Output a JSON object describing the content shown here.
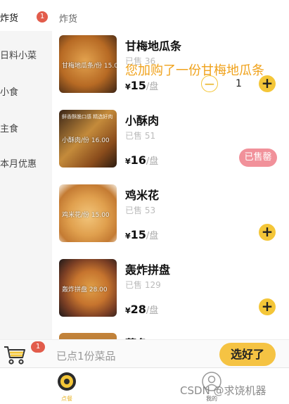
{
  "sidebar": {
    "active": "炸货",
    "items": [
      "日料小菜",
      "小食",
      "主食",
      "本月优惠"
    ],
    "badge": "1"
  },
  "top_tab": "炸货",
  "toast": "您加购了一份甘梅地瓜条",
  "dishes": [
    {
      "name": "甘梅地瓜条",
      "sold": "已售 36",
      "currency": "¥",
      "price": "15",
      "unit": "/盘",
      "overlay": "甘梅地瓜条/份 15.00",
      "quantity": "1"
    },
    {
      "name": "小酥肉",
      "sold": "已售 51",
      "currency": "¥",
      "price": "16",
      "unit": "/盘",
      "overlay": "小酥肉/份 16.00",
      "top_note": "鲜香酥脆口感 精选好肉",
      "status": "已售罄"
    },
    {
      "name": "鸡米花",
      "sold": "已售 53",
      "currency": "¥",
      "price": "15",
      "unit": "/盘",
      "overlay": "鸡米花/份 15.00"
    },
    {
      "name": "轰炸拼盘",
      "sold": "已售 129",
      "currency": "¥",
      "price": "28",
      "unit": "/盘",
      "overlay": "轰炸拼盘 28.00"
    },
    {
      "name": "薯条"
    }
  ],
  "cart": {
    "badge": "1",
    "text": "已点1份菜品",
    "button": "选好了"
  },
  "tabbar": {
    "home_label": "点餐",
    "me_label": "我的"
  },
  "watermark": "CSDN @求饶机器",
  "colors": {
    "accent": "#f5c343",
    "badge": "#e25c4b",
    "toast": "#f0a21b",
    "soldout": "#f1919a"
  }
}
